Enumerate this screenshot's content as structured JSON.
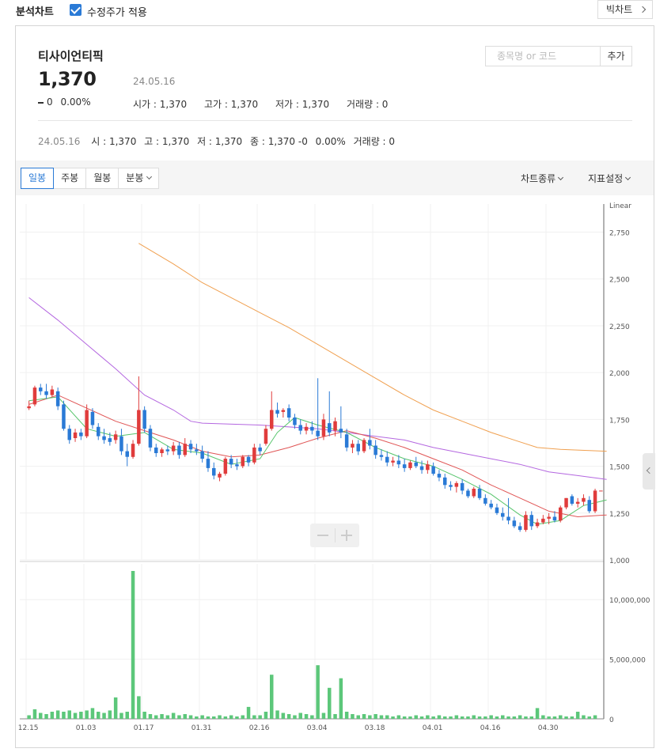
{
  "header": {
    "title": "분석차트",
    "adjusted_price_label": "수정주가 적용",
    "adjusted_price_checked": true,
    "big_chart_label": "빅차트"
  },
  "stock": {
    "name": "티사이언티픽",
    "price": "1,370",
    "date": "24.05.16",
    "change": "0",
    "change_pct": "0.00%",
    "open_label": "시가",
    "open": "1,370",
    "high_label": "고가",
    "high": "1,370",
    "low_label": "저가",
    "low": "1,370",
    "volume_label": "거래량",
    "volume": "0"
  },
  "search": {
    "placeholder": "종목명 or 코드",
    "add_label": "추가"
  },
  "info_row": {
    "date": "24.05.16",
    "o": "시 : 1,370",
    "h": "고 : 1,370",
    "l": "저 : 1,370",
    "c": "종 : 1,370 -0",
    "pct": "0.00%",
    "v": "거래량 : 0"
  },
  "toolbar": {
    "periods": [
      "일봉",
      "주봉",
      "월봉",
      "분봉"
    ],
    "active_period": "일봉",
    "chart_type_label": "차트종류",
    "indicator_label": "지표설정"
  },
  "colors": {
    "up": "#e03c3c",
    "down": "#2a7ad6",
    "ma5": "#55c46a",
    "ma20": "#e05555",
    "ma60": "#b467e0",
    "ma120": "#f0a050",
    "volume": "#5cc77a",
    "accent": "#2a7ad6"
  },
  "chart_data": {
    "type": "candlestick",
    "scale_label": "Linear",
    "price_axis": {
      "ticks": [
        "2,750",
        "2,500",
        "2,250",
        "2,000",
        "1,750",
        "1,500",
        "1,250",
        "1,000"
      ],
      "ylim": [
        1000,
        2900
      ]
    },
    "volume_axis": {
      "ticks": [
        "10,000,000",
        "5,000,000",
        "0"
      ],
      "ylim": [
        0,
        13000000
      ]
    },
    "x_ticks": [
      "12.15",
      "01.03",
      "01.17",
      "01.31",
      "02.16",
      "03.04",
      "03.18",
      "04.01",
      "04.16",
      "04.30"
    ],
    "x_tick_index": [
      0,
      10,
      20,
      30,
      40,
      50,
      60,
      70,
      80,
      90
    ],
    "n_bars": 100,
    "candles": [
      [
        1810,
        1850,
        1800,
        1820
      ],
      [
        1830,
        1930,
        1820,
        1920
      ],
      [
        1920,
        1940,
        1880,
        1900
      ],
      [
        1900,
        1940,
        1860,
        1880
      ],
      [
        1880,
        1930,
        1870,
        1910
      ],
      [
        1900,
        1920,
        1800,
        1820
      ],
      [
        1830,
        1850,
        1690,
        1700
      ],
      [
        1700,
        1720,
        1620,
        1640
      ],
      [
        1650,
        1700,
        1630,
        1680
      ],
      [
        1680,
        1700,
        1640,
        1660
      ],
      [
        1660,
        1830,
        1650,
        1800
      ],
      [
        1790,
        1810,
        1700,
        1720
      ],
      [
        1710,
        1730,
        1640,
        1660
      ],
      [
        1660,
        1700,
        1620,
        1640
      ],
      [
        1650,
        1680,
        1610,
        1630
      ],
      [
        1640,
        1690,
        1620,
        1670
      ],
      [
        1660,
        1700,
        1560,
        1580
      ],
      [
        1580,
        1620,
        1500,
        1550
      ],
      [
        1550,
        1640,
        1540,
        1620
      ],
      [
        1620,
        1980,
        1610,
        1800
      ],
      [
        1800,
        1820,
        1680,
        1700
      ],
      [
        1700,
        1720,
        1580,
        1600
      ],
      [
        1600,
        1620,
        1550,
        1570
      ],
      [
        1570,
        1600,
        1550,
        1590
      ],
      [
        1590,
        1610,
        1560,
        1580
      ],
      [
        1580,
        1630,
        1560,
        1610
      ],
      [
        1610,
        1630,
        1540,
        1560
      ],
      [
        1560,
        1650,
        1550,
        1620
      ],
      [
        1620,
        1640,
        1570,
        1590
      ],
      [
        1590,
        1620,
        1560,
        1580
      ],
      [
        1580,
        1610,
        1520,
        1540
      ],
      [
        1540,
        1580,
        1470,
        1490
      ],
      [
        1490,
        1520,
        1430,
        1450
      ],
      [
        1440,
        1470,
        1420,
        1460
      ],
      [
        1460,
        1550,
        1450,
        1540
      ],
      [
        1540,
        1560,
        1490,
        1510
      ],
      [
        1510,
        1540,
        1480,
        1500
      ],
      [
        1500,
        1560,
        1490,
        1550
      ],
      [
        1550,
        1560,
        1500,
        1520
      ],
      [
        1520,
        1620,
        1510,
        1600
      ],
      [
        1600,
        1620,
        1560,
        1580
      ],
      [
        1620,
        1720,
        1610,
        1700
      ],
      [
        1700,
        1900,
        1690,
        1800
      ],
      [
        1800,
        1840,
        1760,
        1780
      ],
      [
        1790,
        1810,
        1760,
        1800
      ],
      [
        1810,
        1830,
        1740,
        1760
      ],
      [
        1760,
        1780,
        1700,
        1720
      ],
      [
        1720,
        1750,
        1670,
        1690
      ],
      [
        1690,
        1730,
        1670,
        1710
      ],
      [
        1710,
        1740,
        1670,
        1690
      ],
      [
        1690,
        1970,
        1640,
        1660
      ],
      [
        1660,
        1780,
        1640,
        1750
      ],
      [
        1730,
        1900,
        1660,
        1680
      ],
      [
        1690,
        1760,
        1660,
        1740
      ],
      [
        1700,
        1820,
        1650,
        1680
      ],
      [
        1670,
        1700,
        1580,
        1600
      ],
      [
        1600,
        1640,
        1570,
        1620
      ],
      [
        1620,
        1640,
        1560,
        1580
      ],
      [
        1580,
        1650,
        1570,
        1640
      ],
      [
        1640,
        1700,
        1590,
        1610
      ],
      [
        1610,
        1640,
        1540,
        1560
      ],
      [
        1560,
        1590,
        1530,
        1550
      ],
      [
        1550,
        1580,
        1500,
        1520
      ],
      [
        1520,
        1550,
        1500,
        1530
      ],
      [
        1530,
        1560,
        1490,
        1510
      ],
      [
        1510,
        1540,
        1470,
        1490
      ],
      [
        1490,
        1530,
        1480,
        1520
      ],
      [
        1520,
        1550,
        1490,
        1500
      ],
      [
        1500,
        1530,
        1460,
        1480
      ],
      [
        1480,
        1530,
        1460,
        1510
      ],
      [
        1500,
        1520,
        1450,
        1460
      ],
      [
        1460,
        1480,
        1420,
        1440
      ],
      [
        1440,
        1460,
        1380,
        1400
      ],
      [
        1400,
        1420,
        1370,
        1390
      ],
      [
        1390,
        1420,
        1360,
        1410
      ],
      [
        1410,
        1430,
        1350,
        1370
      ],
      [
        1370,
        1380,
        1330,
        1340
      ],
      [
        1340,
        1390,
        1330,
        1380
      ],
      [
        1380,
        1400,
        1320,
        1330
      ],
      [
        1330,
        1350,
        1290,
        1300
      ],
      [
        1300,
        1320,
        1270,
        1280
      ],
      [
        1280,
        1300,
        1240,
        1250
      ],
      [
        1250,
        1280,
        1210,
        1230
      ],
      [
        1230,
        1330,
        1190,
        1210
      ],
      [
        1210,
        1230,
        1170,
        1180
      ],
      [
        1180,
        1200,
        1150,
        1160
      ],
      [
        1160,
        1260,
        1150,
        1240
      ],
      [
        1240,
        1260,
        1160,
        1180
      ],
      [
        1180,
        1220,
        1170,
        1200
      ],
      [
        1200,
        1240,
        1190,
        1220
      ],
      [
        1220,
        1250,
        1190,
        1230
      ],
      [
        1230,
        1260,
        1200,
        1210
      ],
      [
        1210,
        1290,
        1200,
        1280
      ],
      [
        1280,
        1330,
        1270,
        1330
      ],
      [
        1340,
        1350,
        1290,
        1300
      ],
      [
        1300,
        1330,
        1280,
        1310
      ],
      [
        1310,
        1350,
        1290,
        1330
      ],
      [
        1320,
        1340,
        1250,
        1260
      ],
      [
        1260,
        1380,
        1250,
        1370
      ],
      [
        1370,
        1370,
        1370,
        1370
      ]
    ],
    "ma5": [
      [
        0,
        1850
      ],
      [
        5,
        1870
      ],
      [
        10,
        1700
      ],
      [
        15,
        1660
      ],
      [
        20,
        1680
      ],
      [
        25,
        1590
      ],
      [
        30,
        1570
      ],
      [
        35,
        1510
      ],
      [
        40,
        1540
      ],
      [
        43,
        1680
      ],
      [
        46,
        1760
      ],
      [
        50,
        1720
      ],
      [
        55,
        1680
      ],
      [
        60,
        1600
      ],
      [
        65,
        1540
      ],
      [
        70,
        1500
      ],
      [
        75,
        1430
      ],
      [
        80,
        1350
      ],
      [
        85,
        1240
      ],
      [
        88,
        1190
      ],
      [
        92,
        1210
      ],
      [
        96,
        1290
      ],
      [
        100,
        1320
      ]
    ],
    "ma20": [
      [
        0,
        1830
      ],
      [
        5,
        1880
      ],
      [
        10,
        1810
      ],
      [
        15,
        1740
      ],
      [
        20,
        1690
      ],
      [
        25,
        1640
      ],
      [
        30,
        1580
      ],
      [
        35,
        1550
      ],
      [
        40,
        1560
      ],
      [
        45,
        1600
      ],
      [
        50,
        1650
      ],
      [
        55,
        1690
      ],
      [
        60,
        1650
      ],
      [
        65,
        1600
      ],
      [
        70,
        1540
      ],
      [
        75,
        1480
      ],
      [
        80,
        1400
      ],
      [
        85,
        1330
      ],
      [
        90,
        1260
      ],
      [
        95,
        1230
      ],
      [
        100,
        1240
      ]
    ],
    "ma60": [
      [
        0,
        2400
      ],
      [
        5,
        2280
      ],
      [
        10,
        2150
      ],
      [
        15,
        2020
      ],
      [
        20,
        1880
      ],
      [
        25,
        1800
      ],
      [
        28,
        1740
      ],
      [
        30,
        1730
      ],
      [
        40,
        1720
      ],
      [
        50,
        1700
      ],
      [
        55,
        1680
      ],
      [
        60,
        1660
      ],
      [
        65,
        1640
      ],
      [
        70,
        1600
      ],
      [
        75,
        1570
      ],
      [
        80,
        1540
      ],
      [
        85,
        1510
      ],
      [
        90,
        1470
      ],
      [
        95,
        1450
      ],
      [
        100,
        1430
      ]
    ],
    "ma120": [
      [
        19,
        2690
      ],
      [
        25,
        2580
      ],
      [
        30,
        2480
      ],
      [
        35,
        2400
      ],
      [
        40,
        2320
      ],
      [
        45,
        2240
      ],
      [
        50,
        2150
      ],
      [
        55,
        2060
      ],
      [
        60,
        1970
      ],
      [
        65,
        1880
      ],
      [
        70,
        1800
      ],
      [
        75,
        1740
      ],
      [
        80,
        1680
      ],
      [
        85,
        1630
      ],
      [
        88,
        1600
      ],
      [
        92,
        1590
      ],
      [
        100,
        1580
      ]
    ],
    "volume": [
      300000,
      800000,
      500000,
      400000,
      600000,
      700000,
      600000,
      700000,
      500000,
      600000,
      700000,
      900000,
      600000,
      500000,
      700000,
      1800000,
      500000,
      600000,
      12400000,
      1900000,
      600000,
      400000,
      300000,
      400000,
      300000,
      500000,
      300000,
      400000,
      300000,
      200000,
      300000,
      200000,
      200000,
      300000,
      200000,
      300000,
      200000,
      300000,
      1000000,
      300000,
      300000,
      600000,
      3700000,
      700000,
      500000,
      400000,
      300000,
      500000,
      400000,
      300000,
      4500000,
      500000,
      2600000,
      400000,
      3400000,
      600000,
      400000,
      300000,
      400000,
      300000,
      400000,
      300000,
      300000,
      200000,
      300000,
      200000,
      200000,
      300000,
      200000,
      300000,
      200000,
      300000,
      200000,
      200000,
      300000,
      200000,
      200000,
      300000,
      200000,
      200000,
      300000,
      200000,
      300000,
      200000,
      200000,
      300000,
      200000,
      200000,
      900000,
      300000,
      200000,
      200000,
      300000,
      200000,
      200000,
      600000,
      300000,
      200000,
      300000,
      0
    ]
  }
}
